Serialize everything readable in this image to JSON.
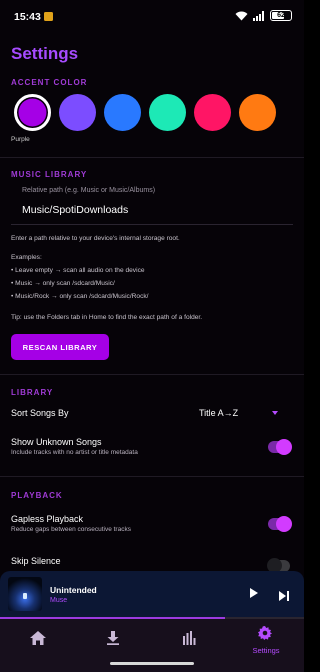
{
  "status_bar": {
    "time": "15:43",
    "battery": "62"
  },
  "page": {
    "title": "Settings"
  },
  "accent": {
    "section_label": "ACCENT COLOR",
    "swatches": [
      {
        "name": "Purple",
        "color": "#a500e6",
        "selected": true
      },
      {
        "color": "#7c4dff"
      },
      {
        "color": "#2979ff"
      },
      {
        "color": "#1de9b6"
      },
      {
        "color": "#ff1565"
      },
      {
        "color": "#ff7a12"
      }
    ],
    "selected_name": "Purple"
  },
  "music_library": {
    "section_label": "MUSIC LIBRARY",
    "path_label": "Relative path (e.g. Music or Music/Albums)",
    "path_value": "Music/SpotiDownloads",
    "help_intro": "Enter a path relative to your device's internal storage root.",
    "examples_label": "Examples:",
    "examples": [
      "• Leave empty → scan all audio on the device",
      "• Music → only scan /sdcard/Music/",
      "• Music/Rock → only scan /sdcard/Music/Rock/"
    ],
    "tip": "Tip: use the Folders tab in Home to find the exact path of a folder.",
    "rescan_button": "RESCAN LIBRARY"
  },
  "library": {
    "section_label": "LIBRARY",
    "sort_label": "Sort Songs By",
    "sort_value": "Title A→Z",
    "unknown_title": "Show Unknown Songs",
    "unknown_sub": "Include tracks with no artist or title metadata",
    "unknown_on": true
  },
  "playback": {
    "section_label": "PLAYBACK",
    "gapless_title": "Gapless Playback",
    "gapless_sub": "Reduce gaps between consecutive tracks",
    "gapless_on": true,
    "skip_title": "Skip Silence",
    "skip_on": false
  },
  "player": {
    "title": "Unintended",
    "artist": "Muse",
    "progress_fraction": 0.74
  },
  "nav": {
    "items": [
      {
        "icon": "home-icon"
      },
      {
        "icon": "download-icon"
      },
      {
        "icon": "equalizer-icon"
      },
      {
        "icon": "settings-icon",
        "label": "Settings",
        "active": true
      }
    ]
  },
  "colors": {
    "accent": "#a500e6",
    "section_label": "#a03bd6",
    "background": "#060308"
  }
}
